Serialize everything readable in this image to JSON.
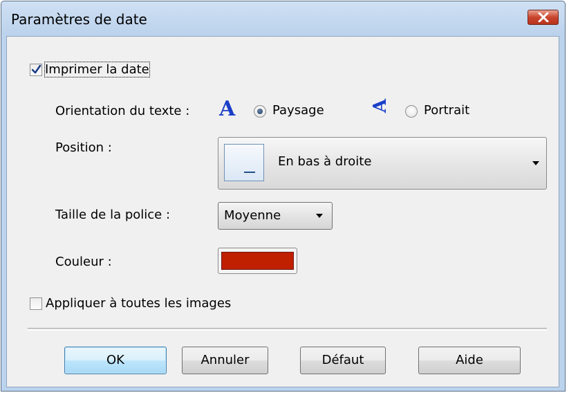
{
  "window": {
    "title": "Paramètres de date"
  },
  "print_date": {
    "label": "Imprimer la date",
    "checked": true
  },
  "orientation": {
    "label": "Orientation du texte :",
    "landscape_label": "Paysage",
    "portrait_label": "Portrait",
    "selected": "Paysage",
    "landscape_icon_glyph": "A",
    "portrait_icon_glyph": "A"
  },
  "position": {
    "label": "Position :",
    "selected": "En bas à droite"
  },
  "font_size": {
    "label": "Taille de la police :",
    "selected": "Moyenne"
  },
  "color": {
    "label": "Couleur :",
    "value": "#c01f00"
  },
  "apply_all": {
    "label": "Appliquer à toutes les images",
    "checked": false
  },
  "buttons": {
    "ok": "OK",
    "cancel": "Annuler",
    "default": "Défaut",
    "help": "Aide"
  }
}
